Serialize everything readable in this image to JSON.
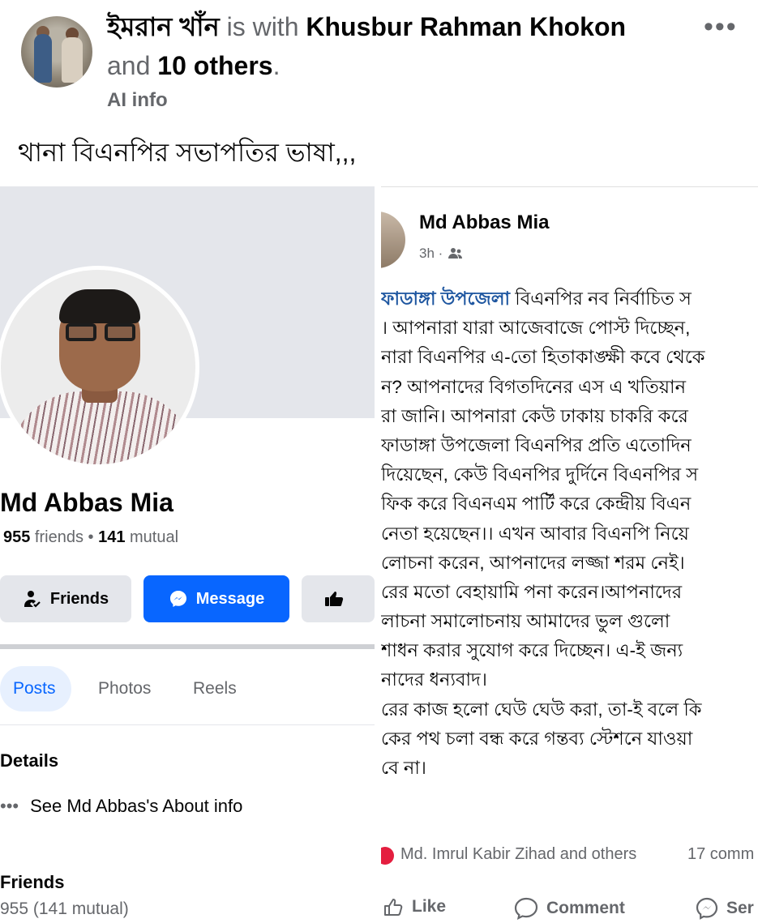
{
  "header": {
    "author": "ইমরান খাঁন",
    "with_text": " is with ",
    "tagged": "Khusbur Rahman Khokon",
    "and_text": "and ",
    "others": "10 others",
    "period": ".",
    "ai_info": "AI info",
    "more": "•••"
  },
  "caption": "থানা বিএনপির সভাপতির ভাষা,,,",
  "profile": {
    "name": "Md Abbas Mia",
    "friends_count": "955",
    "friends_label": " friends",
    "separator": " • ",
    "mutual_count": "141",
    "mutual_label": " mutual",
    "btn_friends": "Friends",
    "btn_message": "Message",
    "tabs": [
      "Posts",
      "Photos",
      "Reels"
    ],
    "details_title": "Details",
    "about_dots": "•••",
    "about_link": "See Md Abbas's About info",
    "friends_title": "Friends",
    "friends_summary": "955 (141 mutual)"
  },
  "post": {
    "author": "Md Abbas Mia",
    "time": "3h ·",
    "tagged_place": "ফাডাঙ্গা উপজেলা",
    "lines": [
      " বিএনপির নব নির্বাচিত স",
      "। আপনারা যারা আজেবাজে পোস্ট দিচ্ছেন,",
      "নারা বিএনপির এ-তো হিতাকাঙ্ক্ষী কবে থেকে",
      "ন? আপনাদের বিগতদিনের এস এ খতিয়ান",
      "রা জানি। আপনারা কেউ ঢাকায় চাকরি করে",
      "ফাডাঙ্গা উপজেলা বিএনপির প্রতি এতোদিন",
      "দিয়েছেন, কেউ বিএনপির দুর্দিনে বিএনপির স",
      "ফিক করে বিএনএম পার্টি করে কেন্দ্রীয় বিএন",
      "নেতা হয়েছেন।। এখন আবার বিএনপি নিয়ে",
      "লোচনা করেন, আপনাদের লজ্জা শরম নেই।",
      "রের মতো বেহায়ামি পনা করেন।আপনাদের",
      "লাচনা সমালোচনায় আমাদের ভুল গুলো",
      "শাধন করার সুযোগ করে দিচ্ছেন। এ-ই জন্য",
      "নাদের ধন্যবাদ।",
      "রের কাজ হলো ঘেউ ঘেউ করা, তা-ই বলে কি",
      "কের পথ চলা বন্ধ করে গন্তব্য স্টেশনে যাওয়া",
      "বে না।"
    ],
    "reactions": "Md. Imrul Kabir Zihad and others",
    "comments": "17 comm",
    "actions": {
      "like": "Like",
      "comment": "Comment",
      "send": "Ser"
    }
  },
  "colors": {
    "accent": "#0866ff",
    "muted": "#65676b",
    "tag_blue": "#1e56a0",
    "react": "#e41e3f"
  },
  "icons": [
    "more-dots-icon",
    "friends-icon",
    "messenger-icon",
    "thumbs-icon",
    "audience-icon",
    "like-icon",
    "comment-icon",
    "send-icon",
    "reaction-icon"
  ]
}
